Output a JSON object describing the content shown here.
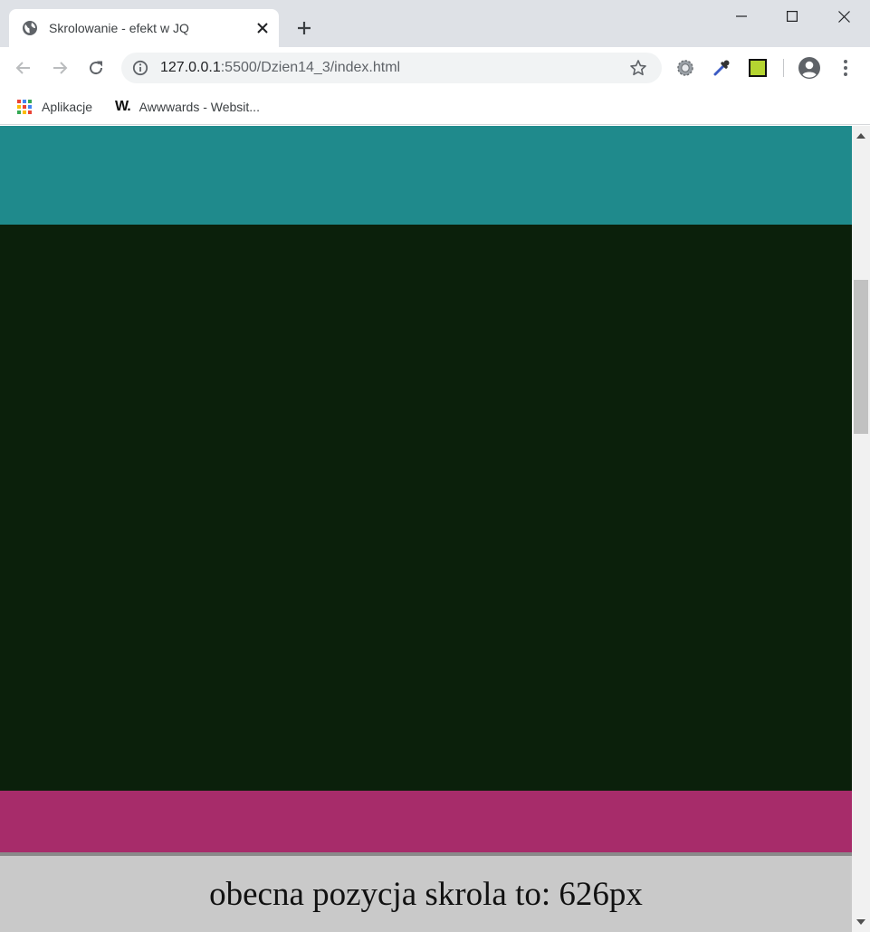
{
  "tab": {
    "title": "Skrolowanie - efekt w JQ",
    "favicon": "globe-icon"
  },
  "omnibox": {
    "url_host": "127.0.0.1",
    "url_rest": ":5500/Dzien14_3/index.html"
  },
  "bookmarks": [
    {
      "label": "Aplikacje",
      "icon": "apps-grid-icon"
    },
    {
      "label": "Awwwards - Websit...",
      "icon": "awwwards-logo",
      "logo_text": "W."
    }
  ],
  "extensions": [
    {
      "icon": "gear-extension-icon"
    },
    {
      "icon": "eyedropper-extension-icon"
    },
    {
      "icon": "m-extension-icon",
      "logo_text": "M"
    }
  ],
  "page": {
    "sections": [
      {
        "name": "teal-section",
        "color": "#1f8a8c"
      },
      {
        "name": "dark-section",
        "color": "#0b200b"
      },
      {
        "name": "pink-section",
        "color": "#a72c6a"
      }
    ],
    "scroll_text": "obecna pozycja skrola to: 626px"
  },
  "colors": {
    "tabstrip": "#dee1e6",
    "omnibox": "#f1f3f4",
    "fixed_bar": "#c9c9c9"
  }
}
